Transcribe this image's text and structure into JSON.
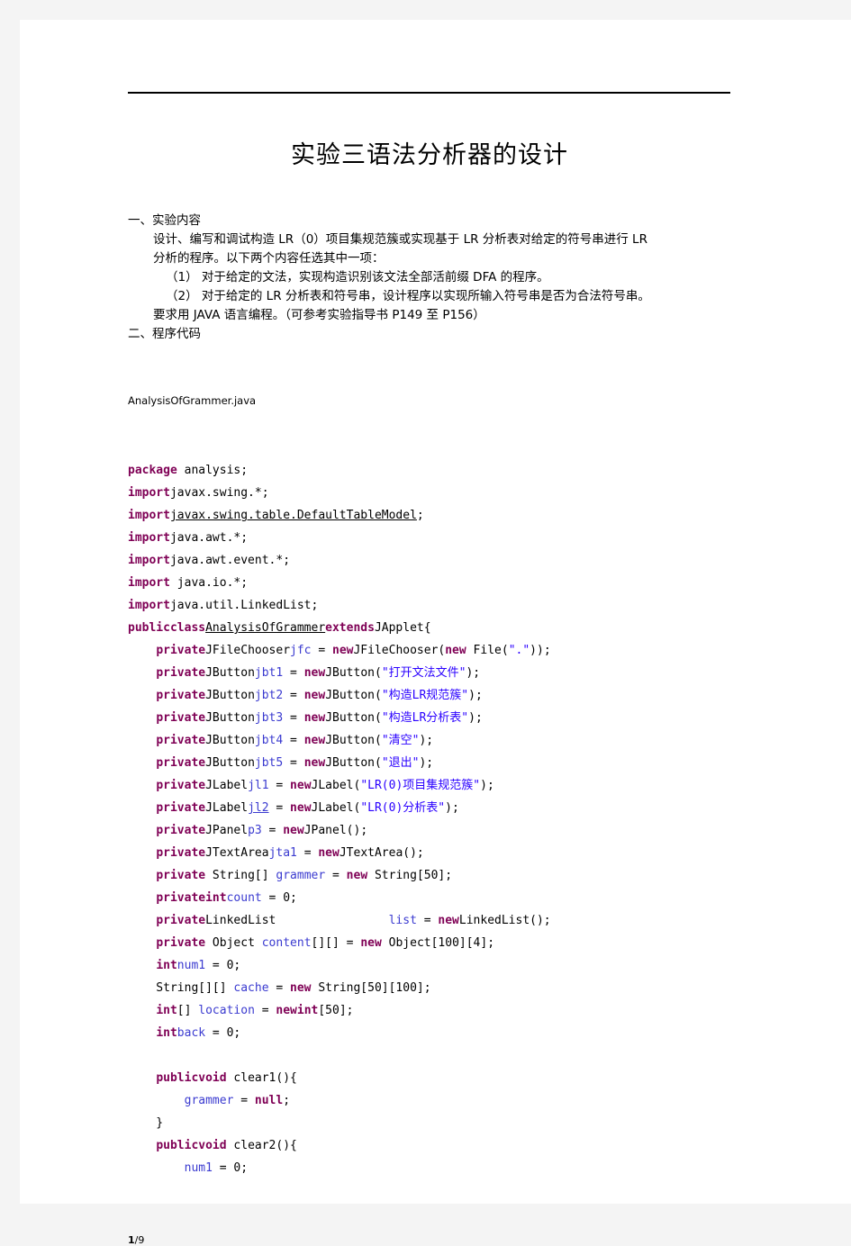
{
  "document": {
    "title": "实验三语法分析器的设计",
    "footer": {
      "current_page": "1",
      "separator": "/",
      "total_pages": "9"
    }
  },
  "sections": [
    {
      "heading": "一、实验内容",
      "lines": [
        {
          "indent": 0,
          "text": "设计、编写和调试构造 LR（0）项目集规范簇或实现基于 LR 分析表对给定的符号串进行 LR"
        },
        {
          "indent": 0,
          "text": "分析的程序。以下两个内容任选其中一项："
        },
        {
          "indent": 1,
          "text": "（1）    对于给定的文法，实现构造识别该文法全部活前缀 DFA 的程序。"
        },
        {
          "indent": 1,
          "text": "（2）    对于给定的 LR 分析表和符号串，设计程序以实现所输入符号串是否为合法符号串。"
        },
        {
          "indent": 0,
          "text": "要求用 JAVA 语言编程。（可参考实验指导书 P149 至 P156）"
        }
      ]
    },
    {
      "heading": "二、程序代码",
      "lines": []
    }
  ],
  "code": {
    "filename": "AnalysisOfGrammer.java",
    "lines": [
      [
        {
          "t": "kw",
          "v": "package"
        },
        {
          "t": "pln",
          "v": " analysis;"
        }
      ],
      [
        {
          "t": "kw",
          "v": "import"
        },
        {
          "t": "pln",
          "v": "javax.swing.*;"
        }
      ],
      [
        {
          "t": "kw",
          "v": "import"
        },
        {
          "t": "und",
          "v": "javax.swing.table.DefaultTableModel"
        },
        {
          "t": "pln",
          "v": ";"
        }
      ],
      [
        {
          "t": "kw",
          "v": "import"
        },
        {
          "t": "pln",
          "v": "java.awt.*;"
        }
      ],
      [
        {
          "t": "kw",
          "v": "import"
        },
        {
          "t": "pln",
          "v": "java.awt.event.*;"
        }
      ],
      [
        {
          "t": "kw",
          "v": "import"
        },
        {
          "t": "pln",
          "v": " java.io.*;"
        }
      ],
      [
        {
          "t": "kw",
          "v": "import"
        },
        {
          "t": "pln",
          "v": "java.util.LinkedList;"
        }
      ],
      [
        {
          "t": "kw",
          "v": "publicclass"
        },
        {
          "t": "undpln",
          "v": "AnalysisOfGrammer"
        },
        {
          "t": "kw",
          "v": "extends"
        },
        {
          "t": "pln",
          "v": "JApplet{"
        }
      ],
      [
        {
          "t": "pln",
          "v": "    "
        },
        {
          "t": "kw",
          "v": "private"
        },
        {
          "t": "pln",
          "v": "JFileChooser"
        },
        {
          "t": "var",
          "v": "jfc"
        },
        {
          "t": "pln",
          "v": " = "
        },
        {
          "t": "kw",
          "v": "new"
        },
        {
          "t": "pln",
          "v": "JFileChooser("
        },
        {
          "t": "kw",
          "v": "new"
        },
        {
          "t": "pln",
          "v": " File("
        },
        {
          "t": "str",
          "v": "\".\""
        },
        {
          "t": "pln",
          "v": "));"
        }
      ],
      [
        {
          "t": "pln",
          "v": "    "
        },
        {
          "t": "kw",
          "v": "private"
        },
        {
          "t": "pln",
          "v": "JButton"
        },
        {
          "t": "var",
          "v": "jbt1"
        },
        {
          "t": "pln",
          "v": " = "
        },
        {
          "t": "kw",
          "v": "new"
        },
        {
          "t": "pln",
          "v": "JButton("
        },
        {
          "t": "str",
          "v": "\"打开文法文件\""
        },
        {
          "t": "pln",
          "v": ");"
        }
      ],
      [
        {
          "t": "pln",
          "v": "    "
        },
        {
          "t": "kw",
          "v": "private"
        },
        {
          "t": "pln",
          "v": "JButton"
        },
        {
          "t": "var",
          "v": "jbt2"
        },
        {
          "t": "pln",
          "v": " = "
        },
        {
          "t": "kw",
          "v": "new"
        },
        {
          "t": "pln",
          "v": "JButton("
        },
        {
          "t": "str",
          "v": "\"构造LR规范簇\""
        },
        {
          "t": "pln",
          "v": ");"
        }
      ],
      [
        {
          "t": "pln",
          "v": "    "
        },
        {
          "t": "kw",
          "v": "private"
        },
        {
          "t": "pln",
          "v": "JButton"
        },
        {
          "t": "var",
          "v": "jbt3"
        },
        {
          "t": "pln",
          "v": " = "
        },
        {
          "t": "kw",
          "v": "new"
        },
        {
          "t": "pln",
          "v": "JButton("
        },
        {
          "t": "str",
          "v": "\"构造LR分析表\""
        },
        {
          "t": "pln",
          "v": ");"
        }
      ],
      [
        {
          "t": "pln",
          "v": "    "
        },
        {
          "t": "kw",
          "v": "private"
        },
        {
          "t": "pln",
          "v": "JButton"
        },
        {
          "t": "var",
          "v": "jbt4"
        },
        {
          "t": "pln",
          "v": " = "
        },
        {
          "t": "kw",
          "v": "new"
        },
        {
          "t": "pln",
          "v": "JButton("
        },
        {
          "t": "str",
          "v": "\"清空\""
        },
        {
          "t": "pln",
          "v": ");"
        }
      ],
      [
        {
          "t": "pln",
          "v": "    "
        },
        {
          "t": "kw",
          "v": "private"
        },
        {
          "t": "pln",
          "v": "JButton"
        },
        {
          "t": "var",
          "v": "jbt5"
        },
        {
          "t": "pln",
          "v": " = "
        },
        {
          "t": "kw",
          "v": "new"
        },
        {
          "t": "pln",
          "v": "JButton("
        },
        {
          "t": "str",
          "v": "\"退出\""
        },
        {
          "t": "pln",
          "v": ");"
        }
      ],
      [
        {
          "t": "pln",
          "v": "    "
        },
        {
          "t": "kw",
          "v": "private"
        },
        {
          "t": "pln",
          "v": "JLabel"
        },
        {
          "t": "var",
          "v": "jl1"
        },
        {
          "t": "pln",
          "v": " = "
        },
        {
          "t": "kw",
          "v": "new"
        },
        {
          "t": "pln",
          "v": "JLabel("
        },
        {
          "t": "str",
          "v": "\"LR(0)项目集规范簇\""
        },
        {
          "t": "pln",
          "v": ");"
        }
      ],
      [
        {
          "t": "pln",
          "v": "    "
        },
        {
          "t": "kw",
          "v": "private"
        },
        {
          "t": "pln",
          "v": "JLabel"
        },
        {
          "t": "undvar",
          "v": "jl2"
        },
        {
          "t": "pln",
          "v": " = "
        },
        {
          "t": "kw",
          "v": "new"
        },
        {
          "t": "pln",
          "v": "JLabel("
        },
        {
          "t": "str",
          "v": "\"LR(0)分析表\""
        },
        {
          "t": "pln",
          "v": ");"
        }
      ],
      [
        {
          "t": "pln",
          "v": "    "
        },
        {
          "t": "kw",
          "v": "private"
        },
        {
          "t": "pln",
          "v": "JPanel"
        },
        {
          "t": "var",
          "v": "p3"
        },
        {
          "t": "pln",
          "v": " = "
        },
        {
          "t": "kw",
          "v": "new"
        },
        {
          "t": "pln",
          "v": "JPanel();"
        }
      ],
      [
        {
          "t": "pln",
          "v": "    "
        },
        {
          "t": "kw",
          "v": "private"
        },
        {
          "t": "pln",
          "v": "JTextArea"
        },
        {
          "t": "var",
          "v": "jta1"
        },
        {
          "t": "pln",
          "v": " = "
        },
        {
          "t": "kw",
          "v": "new"
        },
        {
          "t": "pln",
          "v": "JTextArea();"
        }
      ],
      [
        {
          "t": "pln",
          "v": "    "
        },
        {
          "t": "kw",
          "v": "private"
        },
        {
          "t": "pln",
          "v": " String[] "
        },
        {
          "t": "var",
          "v": "grammer"
        },
        {
          "t": "pln",
          "v": " = "
        },
        {
          "t": "kw",
          "v": "new"
        },
        {
          "t": "pln",
          "v": " String[50];"
        }
      ],
      [
        {
          "t": "pln",
          "v": "    "
        },
        {
          "t": "kw",
          "v": "privateint"
        },
        {
          "t": "var",
          "v": "count"
        },
        {
          "t": "pln",
          "v": " = 0;"
        }
      ],
      [
        {
          "t": "pln",
          "v": "    "
        },
        {
          "t": "kw",
          "v": "private"
        },
        {
          "t": "pln",
          "v": "LinkedList                "
        },
        {
          "t": "var",
          "v": "list"
        },
        {
          "t": "pln",
          "v": " = "
        },
        {
          "t": "kw",
          "v": "new"
        },
        {
          "t": "pln",
          "v": "LinkedList();"
        }
      ],
      [
        {
          "t": "pln",
          "v": "    "
        },
        {
          "t": "kw",
          "v": "private"
        },
        {
          "t": "pln",
          "v": " Object "
        },
        {
          "t": "var",
          "v": "content"
        },
        {
          "t": "pln",
          "v": "[][] = "
        },
        {
          "t": "kw",
          "v": "new"
        },
        {
          "t": "pln",
          "v": " Object[100][4];"
        }
      ],
      [
        {
          "t": "pln",
          "v": "    "
        },
        {
          "t": "kw",
          "v": "int"
        },
        {
          "t": "var",
          "v": "num1"
        },
        {
          "t": "pln",
          "v": " = 0;"
        }
      ],
      [
        {
          "t": "pln",
          "v": "    String[][] "
        },
        {
          "t": "var",
          "v": "cache"
        },
        {
          "t": "pln",
          "v": " = "
        },
        {
          "t": "kw",
          "v": "new"
        },
        {
          "t": "pln",
          "v": " String[50][100];"
        }
      ],
      [
        {
          "t": "pln",
          "v": "    "
        },
        {
          "t": "kw",
          "v": "int"
        },
        {
          "t": "pln",
          "v": "[] "
        },
        {
          "t": "var",
          "v": "location"
        },
        {
          "t": "pln",
          "v": " = "
        },
        {
          "t": "kw",
          "v": "newint"
        },
        {
          "t": "pln",
          "v": "[50];"
        }
      ],
      [
        {
          "t": "pln",
          "v": "    "
        },
        {
          "t": "kw",
          "v": "int"
        },
        {
          "t": "var",
          "v": "back"
        },
        {
          "t": "pln",
          "v": " = 0;"
        }
      ],
      [
        {
          "t": "pln",
          "v": ""
        }
      ],
      [
        {
          "t": "pln",
          "v": "    "
        },
        {
          "t": "kw",
          "v": "publicvoid"
        },
        {
          "t": "pln",
          "v": " clear1(){"
        }
      ],
      [
        {
          "t": "pln",
          "v": "        "
        },
        {
          "t": "var",
          "v": "grammer"
        },
        {
          "t": "pln",
          "v": " = "
        },
        {
          "t": "kw",
          "v": "null"
        },
        {
          "t": "pln",
          "v": ";"
        }
      ],
      [
        {
          "t": "pln",
          "v": "    }"
        }
      ],
      [
        {
          "t": "pln",
          "v": "    "
        },
        {
          "t": "kw",
          "v": "publicvoid"
        },
        {
          "t": "pln",
          "v": " clear2(){"
        }
      ],
      [
        {
          "t": "pln",
          "v": "        "
        },
        {
          "t": "var",
          "v": "num1"
        },
        {
          "t": "pln",
          "v": " = 0;"
        }
      ]
    ]
  },
  "colors": {
    "keyword": "#7f0055",
    "string": "#2a00ff",
    "variable": "#3b3bd0",
    "plain": "#000000",
    "page_background": "#ffffff",
    "canvas_background": "#f4f4f4"
  }
}
